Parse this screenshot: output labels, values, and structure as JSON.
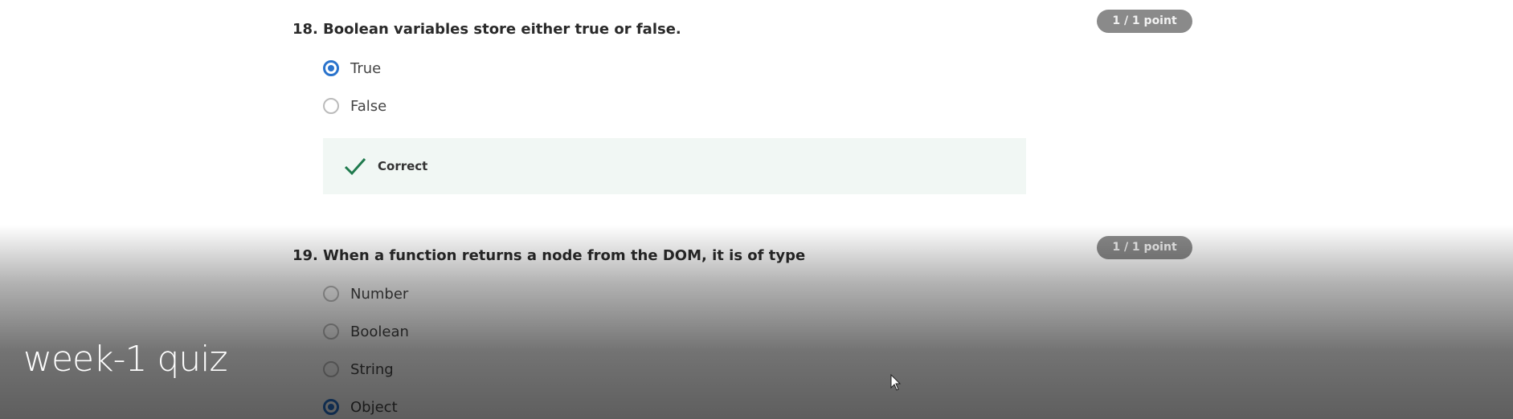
{
  "questions": [
    {
      "number": "18.",
      "title": "Boolean variables store either true or false.",
      "score": "1 / 1 point",
      "options": [
        "True",
        "False"
      ],
      "selected": 0,
      "feedback": "Correct"
    },
    {
      "number": "19.",
      "title": "When a function returns a node from the DOM, it is of type",
      "score": "1 / 1 point",
      "options": [
        "Number",
        "Boolean",
        "String",
        "Object"
      ],
      "selected": 3
    }
  ],
  "video_title": "week-1 quiz",
  "colors": {
    "accent": "#2a73cc",
    "correct": "#1f7a4d",
    "badge": "#8a8a8a",
    "feedback_bg": "#f1f7f4"
  }
}
